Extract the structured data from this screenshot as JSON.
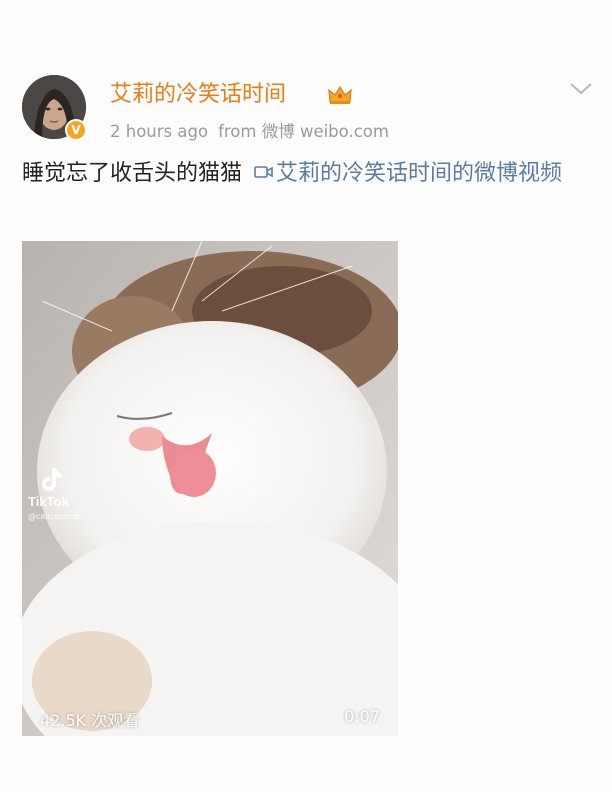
{
  "post": {
    "username": "艾莉的冷笑话时间",
    "verified_badge": "V",
    "timestamp": "2 hours ago",
    "source": "from 微博 weibo.com",
    "text": "睡觉忘了收舌头的猫猫",
    "link_text": "艾莉的冷笑话时间的微博视频",
    "icons": [
      "avatar",
      "verified-badge-icon",
      "crown-icon",
      "chevron-down-icon",
      "video-link-icon",
      "tiktok-logo-icon"
    ],
    "colors": {
      "username": "#ec7c12",
      "link": "#5a7ca3",
      "verified": "#f6a623",
      "meta": "#9a9a9a"
    }
  },
  "video": {
    "watermark": "TikTok",
    "watermark_handle": "@calicosclub",
    "views": "42.5K 次观看",
    "duration": "0:07"
  }
}
